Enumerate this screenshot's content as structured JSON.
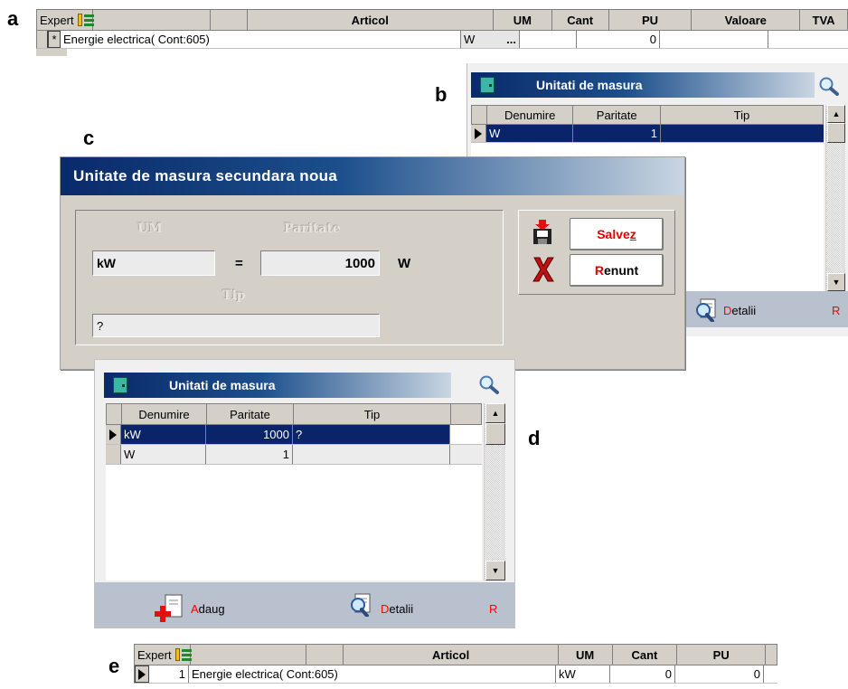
{
  "labels": {
    "a": "a",
    "b": "b",
    "c": "c",
    "d": "d",
    "e": "e"
  },
  "grid_a": {
    "expert_label": "Expert",
    "columns": [
      "Articol",
      "UM",
      "Cant",
      "PU",
      "Valoare",
      "TVA"
    ],
    "row": {
      "indicator": "*",
      "articol": "Energie electrica( Cont:605)",
      "um": "W",
      "um_button": "...",
      "cant": "",
      "pu": "0",
      "valoare": "",
      "tva": ""
    }
  },
  "window_b": {
    "title": "Unitati de masura",
    "columns": [
      "Denumire",
      "Paritate",
      "Tip"
    ],
    "rows": [
      {
        "denumire": "W",
        "paritate": "1",
        "tip": ""
      }
    ],
    "footer": {
      "detalii_hot": "D",
      "detalii_rest": "etalii",
      "r": "R"
    }
  },
  "dialog_c": {
    "title": "Unitate de masura secundara noua",
    "um_label": "UM",
    "paritate_label": "Paritate",
    "tip_label": "Tip",
    "um_value": "kW",
    "equals": "=",
    "paritate_value": "1000",
    "unit": "W",
    "tip_value": "?",
    "save": {
      "text": "Salve",
      "hot": "z"
    },
    "cancel": {
      "hot": "R",
      "text": "enunt"
    }
  },
  "window_d": {
    "title": "Unitati de masura",
    "columns": [
      "Denumire",
      "Paritate",
      "Tip"
    ],
    "rows": [
      {
        "denumire": "kW",
        "paritate": "1000",
        "tip": "?"
      },
      {
        "denumire": "W",
        "paritate": "1",
        "tip": ""
      }
    ],
    "footer": {
      "adaug_hot": "A",
      "adaug_rest": "daug",
      "detalii_hot": "D",
      "detalii_rest": "etalii",
      "r": "R"
    }
  },
  "grid_e": {
    "expert_label": "Expert",
    "columns": [
      "Articol",
      "UM",
      "Cant",
      "PU"
    ],
    "row": {
      "nr": "1",
      "articol": "Energie electrica( Cont:605)",
      "um": "kW",
      "cant": "0",
      "pu": "0"
    }
  },
  "colors": {
    "selection": "#0a246a",
    "title_start": "#0a2a6a",
    "footer": "#b9c1cf",
    "hotkey": "#ff0000",
    "dialog_bg": "#d4d0c8"
  }
}
